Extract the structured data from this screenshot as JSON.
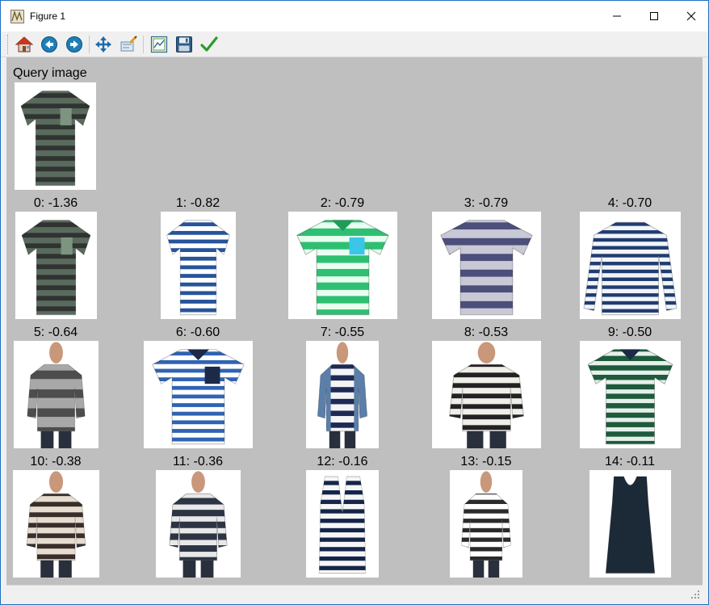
{
  "window": {
    "title": "Figure 1"
  },
  "toolbar": {
    "buttons": [
      {
        "name": "home-button",
        "icon": "home-icon"
      },
      {
        "name": "back-button",
        "icon": "arrow-left-icon"
      },
      {
        "name": "forward-button",
        "icon": "arrow-right-icon"
      },
      {
        "name": "pan-button",
        "icon": "move-arrows-icon"
      },
      {
        "name": "zoom-button",
        "icon": "zoom-rect-icon"
      },
      {
        "name": "subplots-button",
        "icon": "configure-subplots-icon"
      },
      {
        "name": "save-button",
        "icon": "floppy-disk-icon"
      },
      {
        "name": "customize-button",
        "icon": "checkmark-icon"
      }
    ]
  },
  "figure": {
    "query_title": "Query image",
    "query_item": {
      "kind": "tee",
      "bg": "#5a6b5e",
      "stripe": "#2f3331",
      "pocket": "#7d9480",
      "stripes": 9
    },
    "results": [
      {
        "label": "0: -1.36",
        "kind": "tee",
        "bg": "#5a6b5e",
        "stripe": "#2f3331",
        "pocket": "#7d9480",
        "stripes": 9
      },
      {
        "label": "1: -0.82",
        "kind": "tee",
        "bg": "#ffffff",
        "stripe": "#27549a",
        "stripes": 11
      },
      {
        "label": "2: -0.79",
        "kind": "polo",
        "bg": "#2fbf72",
        "stripe": "#e8fff0",
        "pocket": "#39c6e9",
        "stripes": 7
      },
      {
        "label": "3: -0.79",
        "kind": "tee",
        "bg": "#c9c9d6",
        "stripe": "#4b4f7a",
        "stripes": 6
      },
      {
        "label": "4: -0.70",
        "kind": "longsleeve",
        "bg": "#f2f4f8",
        "stripe": "#1f3d70",
        "stripes": 12
      },
      {
        "label": "5: -0.64",
        "kind": "person",
        "bg": "#a8a8a8",
        "stripe": "#4d4d4d",
        "stripes": 5
      },
      {
        "label": "6: -0.60",
        "kind": "polo",
        "bg": "#ffffff",
        "stripe": "#2f64b3",
        "pocket": "#1c2a48",
        "stripes": 11
      },
      {
        "label": "7: -0.55",
        "kind": "person",
        "bg": "#f4f4f4",
        "stripe": "#1e2a55",
        "jacket": "#5b7fa8",
        "stripes": 8
      },
      {
        "label": "8: -0.53",
        "kind": "person",
        "bg": "#f0eee9",
        "stripe": "#222222",
        "stripes": 9
      },
      {
        "label": "9: -0.50",
        "kind": "polo",
        "bg": "#1e5a3c",
        "stripe": "#e6f0ea",
        "stripes": 10
      },
      {
        "label": "10: -0.38",
        "kind": "person",
        "bg": "#e6ddd0",
        "stripe": "#3a2e2a",
        "stripes": 9
      },
      {
        "label": "11: -0.36",
        "kind": "person",
        "bg": "#2d3444",
        "stripe": "#e8e8e8",
        "stripes": 8
      },
      {
        "label": "12: -0.16",
        "kind": "vest",
        "bg": "#f6f6f6",
        "stripe": "#15254a",
        "stripes": 10
      },
      {
        "label": "13: -0.15",
        "kind": "person",
        "bg": "#ffffff",
        "stripe": "#2a2a2a",
        "stripes": 10
      },
      {
        "label": "14: -0.11",
        "kind": "tank",
        "bg": "#1c2a38",
        "stripe": "#1c2a38",
        "stripes": 0
      }
    ]
  }
}
